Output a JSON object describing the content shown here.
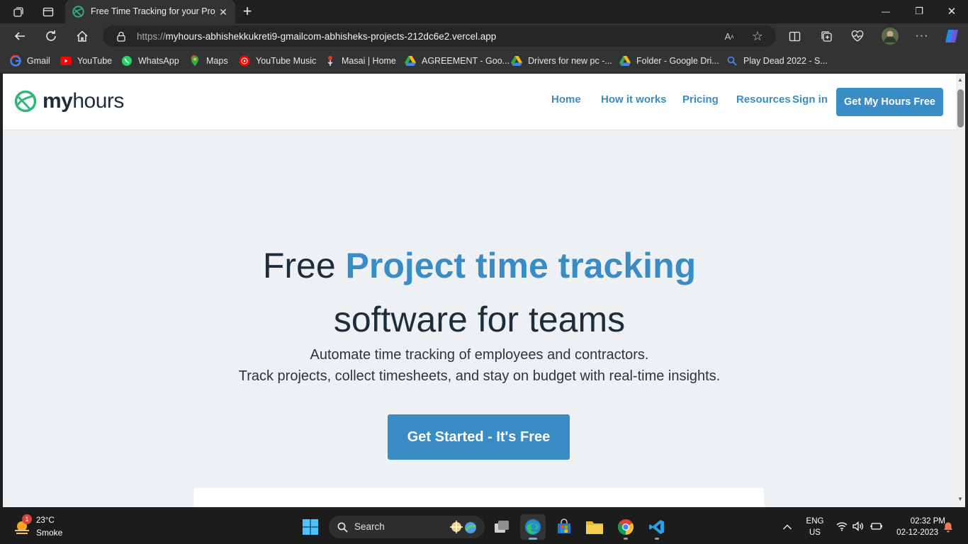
{
  "browser": {
    "tab": {
      "title": "Free Time Tracking for your Proje",
      "close_glyph": "✕"
    },
    "new_tab_glyph": "+",
    "window_controls": {
      "minimize": "—",
      "maximize": "❐",
      "close": "✕"
    },
    "address": {
      "scheme": "https://",
      "host_path": "myhours-abhishekkukreti9-gmailcom-abhisheks-projects-212dc6e2.vercel.app"
    },
    "bookmarks": [
      {
        "label": "Gmail",
        "icon": "google-icon"
      },
      {
        "label": "YouTube",
        "icon": "youtube-icon"
      },
      {
        "label": "WhatsApp",
        "icon": "whatsapp-icon"
      },
      {
        "label": "Maps",
        "icon": "maps-pin-icon"
      },
      {
        "label": "YouTube Music",
        "icon": "youtube-music-icon"
      },
      {
        "label": "Masai | Home",
        "icon": "masai-icon"
      },
      {
        "label": "AGREEMENT - Goo...",
        "icon": "google-drive-icon"
      },
      {
        "label": "Drivers for new pc -...",
        "icon": "google-drive-icon"
      },
      {
        "label": "Folder - Google Dri...",
        "icon": "google-drive-icon"
      },
      {
        "label": "Play Dead 2022 - S...",
        "icon": "search-icon"
      }
    ]
  },
  "site": {
    "logo": {
      "bold": "my",
      "regular": "hours"
    },
    "nav": [
      "Home",
      "How it works",
      "Pricing",
      "Resources",
      "Sign in"
    ],
    "header_cta": "Get My Hours Free",
    "hero": {
      "line1_plain": "Free ",
      "line1_highlight": "Project time tracking",
      "line2": "software for teams",
      "sub1": "Automate time tracking of employees and contractors.",
      "sub2": "Track projects, collect timesheets, and stay on budget with real-time insights.",
      "cta": "Get Started - It's Free"
    }
  },
  "taskbar": {
    "weather": {
      "temp": "23°C",
      "condition": "Smoke",
      "badge": "1"
    },
    "search_label": "Search",
    "language": {
      "line1": "ENG",
      "line2": "US"
    },
    "clock": {
      "time": "02:32 PM",
      "date": "02-12-2023"
    }
  },
  "colors": {
    "accent": "#3a8cc4",
    "page_bg": "#eef1f4",
    "text_dark": "#1f2d3a",
    "chrome_bg": "#202020"
  }
}
